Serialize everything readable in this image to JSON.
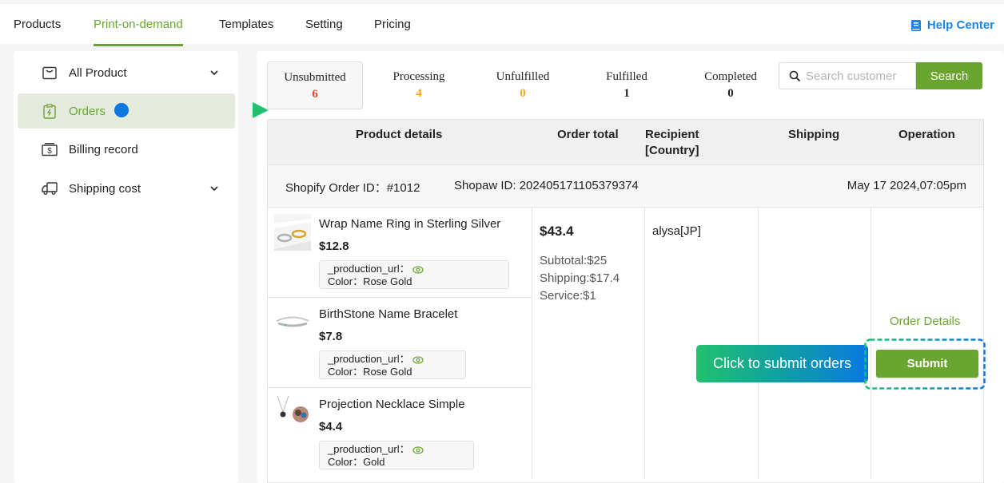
{
  "topnav": {
    "tabs": [
      {
        "label": "Products",
        "active": false
      },
      {
        "label": "Print-on-demand",
        "active": true
      },
      {
        "label": "Templates",
        "active": false
      },
      {
        "label": "Setting",
        "active": false
      },
      {
        "label": "Pricing",
        "active": false
      }
    ],
    "help": {
      "label": "Help Center",
      "icon": "book-icon"
    },
    "accent": "#6aa531",
    "link_color": "#1a85e8"
  },
  "sidebar": {
    "items": [
      {
        "label": "All Product",
        "icon": "shopping-bag-icon",
        "has_chevron": true,
        "active": false
      },
      {
        "label": "Orders",
        "icon": "clipboard-icon",
        "has_chevron": false,
        "active": true
      },
      {
        "label": "Billing record",
        "icon": "billing-icon",
        "has_chevron": false,
        "active": false
      },
      {
        "label": "Shipping cost",
        "icon": "truck-icon",
        "has_chevron": true,
        "active": false
      }
    ]
  },
  "status_tabs": [
    {
      "label": "Unsubmitted",
      "count": "6",
      "color": "#f04134",
      "active": true
    },
    {
      "label": "Processing",
      "count": "4",
      "color": "#f5a623",
      "active": false
    },
    {
      "label": "Unfulfilled",
      "count": "0",
      "color": "#f5a623",
      "active": false
    },
    {
      "label": "Fulfilled",
      "count": "1",
      "color": "#222222",
      "active": false
    },
    {
      "label": "Completed",
      "count": "0",
      "color": "#222222",
      "active": false
    }
  ],
  "search": {
    "placeholder": "Search customer",
    "value": "",
    "button_label": "Search"
  },
  "table": {
    "headers": {
      "product_details": "Product details",
      "order_total": "Order total",
      "recipient_line1": "Recipient",
      "recipient_line2": "[Country]",
      "shipping": "Shipping",
      "operation": "Operation"
    },
    "order": {
      "shopify_order_id": "Shopify Order ID：#1012",
      "shopaw_id": "Shopaw ID: 202405171105379374",
      "date": "May 17 2024,07:05pm",
      "products": [
        {
          "name": "Wrap Name Ring in Sterling Silver",
          "price": "$12.8",
          "url_label": "_production_url：",
          "color": "Color：Rose Gold",
          "image": "ring-thumbnail"
        },
        {
          "name": "BirthStone Name Bracelet",
          "price": "$7.8",
          "url_label": "_production_url：",
          "color": "Color：Rose Gold",
          "image": "bracelet-thumbnail"
        },
        {
          "name": "Projection Necklace Simple",
          "price": "$4.4",
          "url_label": "_production_url：",
          "color": "Color：Gold",
          "image": "necklace-thumbnail"
        }
      ],
      "total": "$43.4",
      "subtotal": "Subtotal:$25",
      "shipping_cost": "Shipping:$17.4",
      "service": "Service:$1",
      "recipient": "alysa[JP]",
      "order_details_link": "Order Details",
      "submit_label": "Submit"
    }
  },
  "annotation": {
    "callout_text": "Click to submit orders"
  }
}
